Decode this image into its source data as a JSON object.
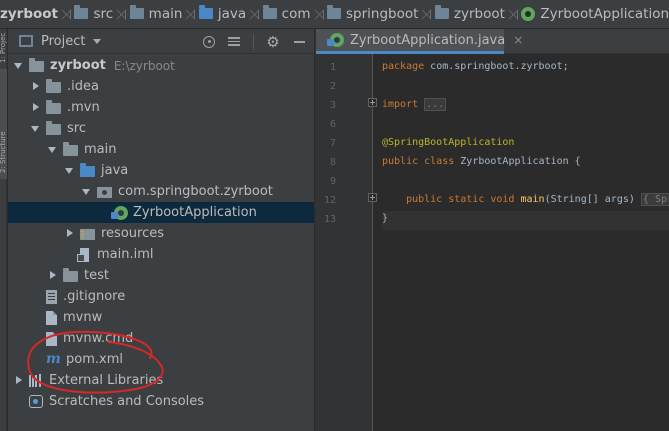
{
  "breadcrumb": [
    "zyrboot",
    "src",
    "main",
    "java",
    "com",
    "springboot",
    "zyrboot",
    "ZyrbootApplication"
  ],
  "left_strip": {
    "tab1": "1: Project",
    "tab2": "2: Structure"
  },
  "project_panel": {
    "title": "Project",
    "tools": [
      "locate-icon",
      "collapse-all-icon",
      "gear-icon",
      "minimize-icon"
    ]
  },
  "tree": [
    {
      "label": "zyrboot",
      "secondary": "E:\\zyrboot",
      "depth": 0,
      "arrow": "down",
      "icon": "folder",
      "bold": true
    },
    {
      "label": ".idea",
      "depth": 1,
      "arrow": "right",
      "icon": "folder"
    },
    {
      "label": ".mvn",
      "depth": 1,
      "arrow": "right",
      "icon": "folder"
    },
    {
      "label": "src",
      "depth": 1,
      "arrow": "down",
      "icon": "folder"
    },
    {
      "label": "main",
      "depth": 2,
      "arrow": "down",
      "icon": "folder"
    },
    {
      "label": "java",
      "depth": 3,
      "arrow": "down",
      "icon": "folder-blue"
    },
    {
      "label": "com.springboot.zyrboot",
      "depth": 4,
      "arrow": "down",
      "icon": "package"
    },
    {
      "label": "ZyrbootApplication",
      "depth": 5,
      "arrow": "none",
      "icon": "spring",
      "selected": true
    },
    {
      "label": "resources",
      "depth": 3,
      "arrow": "right",
      "icon": "folder-res"
    },
    {
      "label": "main.iml",
      "depth": 3,
      "arrow": "none",
      "icon": "iml"
    },
    {
      "label": "test",
      "depth": 2,
      "arrow": "right",
      "icon": "folder"
    },
    {
      "label": ".gitignore",
      "depth": 1,
      "arrow": "none",
      "icon": "gitig"
    },
    {
      "label": "mvnw",
      "depth": 1,
      "arrow": "none",
      "icon": "file"
    },
    {
      "label": "mvnw.cmd",
      "depth": 1,
      "arrow": "none",
      "icon": "file"
    },
    {
      "label": "pom.xml",
      "depth": 1,
      "arrow": "none",
      "icon": "maven"
    },
    {
      "label": "External Libraries",
      "depth": 0,
      "arrow": "right",
      "icon": "libs"
    },
    {
      "label": "Scratches and Consoles",
      "depth": 0,
      "arrow": "none",
      "icon": "scratch"
    }
  ],
  "editor": {
    "tab_label": "ZyrbootApplication.java",
    "tab_close": "×",
    "line_numbers": [
      "1",
      "2",
      "3",
      "6",
      "7",
      "8",
      "9",
      "12",
      "13"
    ],
    "code": {
      "l1_kw": "package ",
      "l1_rest": "com.springboot.zyrboot;",
      "l3_kw": "import ",
      "l3_fold": "...",
      "l6_ann": "@SpringBootApplication",
      "l7_kw": "public class ",
      "l7_rest": "ZyrbootApplication {",
      "l9_kw": "    public static void ",
      "l9_fn": "main",
      "l9_rest": "(String[] args) ",
      "l9_fold": "{ Spr",
      "l12": "}"
    }
  },
  "annotation": {
    "color": "#d62828",
    "target": "pom.xml"
  }
}
